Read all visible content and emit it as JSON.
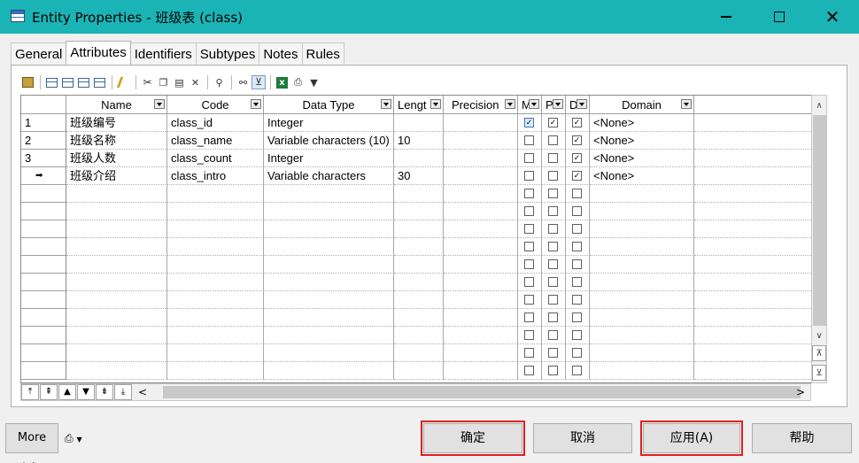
{
  "window": {
    "title": "Entity Properties - 班级表 (class)"
  },
  "tabs": [
    "General",
    "Attributes",
    "Identifiers",
    "Subtypes",
    "Notes",
    "Rules"
  ],
  "active_tab": "Attributes",
  "grid": {
    "columns": [
      "Name",
      "Code",
      "Data Type",
      "Lengt",
      "Precision",
      "M",
      "P",
      "D",
      "Domain"
    ],
    "rows": [
      {
        "marker": "1",
        "name": "班级编号",
        "code": "class_id",
        "data_type": "Integer",
        "length": "",
        "precision": "",
        "m": true,
        "p": true,
        "d": true,
        "domain": "<None>"
      },
      {
        "marker": "2",
        "name": "班级名称",
        "code": "class_name",
        "data_type": "Variable characters (10)",
        "length": "10",
        "precision": "",
        "m": false,
        "p": false,
        "d": true,
        "domain": "<None>"
      },
      {
        "marker": "3",
        "name": "班级人数",
        "code": "class_count",
        "data_type": "Integer",
        "length": "",
        "precision": "",
        "m": false,
        "p": false,
        "d": true,
        "domain": "<None>"
      },
      {
        "marker": "➡",
        "name": "班级介绍",
        "code": "class_intro",
        "data_type": "Variable characters",
        "length": "30",
        "precision": "",
        "m": false,
        "p": false,
        "d": true,
        "domain": "<None>"
      }
    ],
    "empty_rows": 11
  },
  "buttons": {
    "more": "More >>",
    "ok": "确定",
    "cancel": "取消",
    "apply": "应用(A)",
    "help": "帮助"
  }
}
